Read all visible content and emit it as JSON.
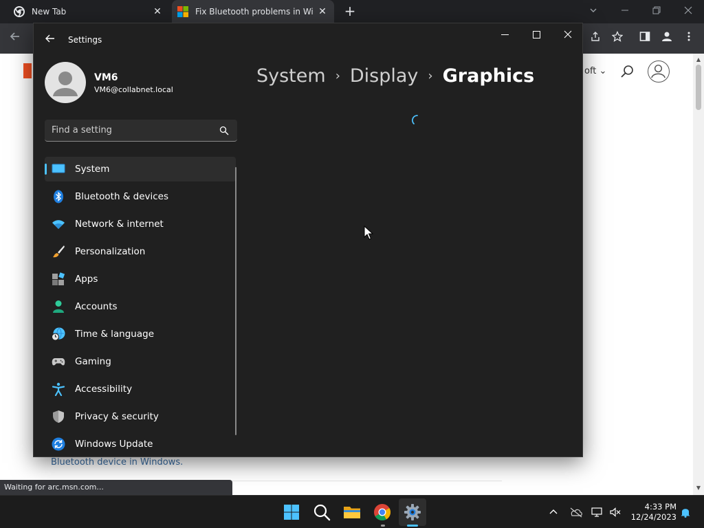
{
  "browser": {
    "tabs": [
      {
        "title": "New Tab",
        "active": false
      },
      {
        "title": "Fix Bluetooth problems in Windows",
        "active": true
      }
    ],
    "new_tab_glyph": "+",
    "close_glyph": "✕",
    "status_text": "Waiting for arc.msn.com..."
  },
  "webpage": {
    "header_partial_text": "oft",
    "header_chevron": "⌄",
    "link_text": "Bluetooth device in Windows."
  },
  "settings": {
    "window_title": "Settings",
    "profile": {
      "name": "VM6",
      "email": "VM6@collabnet.local"
    },
    "search": {
      "placeholder": "Find a setting"
    },
    "nav": [
      {
        "label": "System",
        "icon": "system-icon",
        "active": true
      },
      {
        "label": "Bluetooth & devices",
        "icon": "bluetooth-icon",
        "active": false
      },
      {
        "label": "Network & internet",
        "icon": "wifi-icon",
        "active": false
      },
      {
        "label": "Personalization",
        "icon": "brush-icon",
        "active": false
      },
      {
        "label": "Apps",
        "icon": "apps-icon",
        "active": false
      },
      {
        "label": "Accounts",
        "icon": "accounts-icon",
        "active": false
      },
      {
        "label": "Time & language",
        "icon": "time-language-icon",
        "active": false
      },
      {
        "label": "Gaming",
        "icon": "gaming-icon",
        "active": false
      },
      {
        "label": "Accessibility",
        "icon": "accessibility-icon",
        "active": false
      },
      {
        "label": "Privacy & security",
        "icon": "shield-icon",
        "active": false
      },
      {
        "label": "Windows Update",
        "icon": "update-icon",
        "active": false
      }
    ],
    "breadcrumb": {
      "items": [
        "System",
        "Display"
      ],
      "current": "Graphics",
      "separator": "›"
    },
    "accent": "#4cc2ff"
  },
  "taskbar": {
    "clock_time": "4:33 PM",
    "clock_date": "12/24/2023",
    "tray_chevron": "^"
  }
}
